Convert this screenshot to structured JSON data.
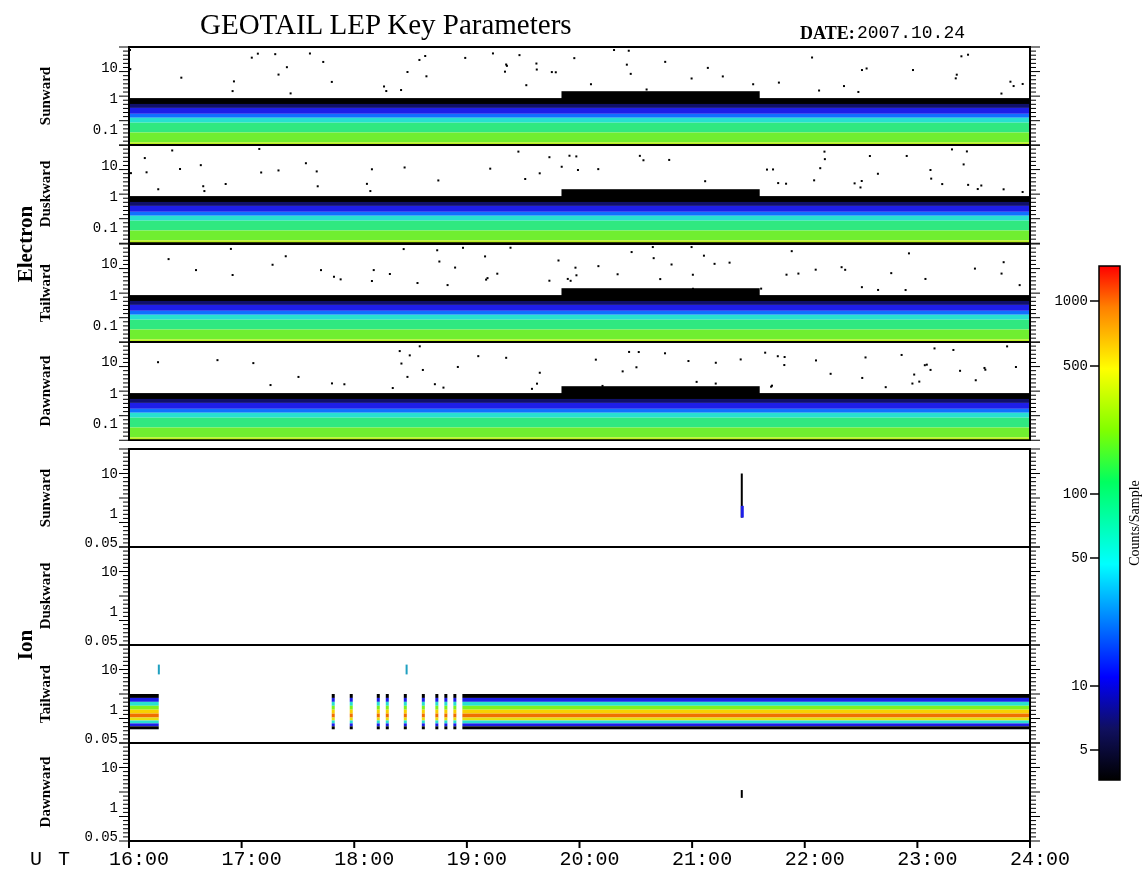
{
  "title": "GEOTAIL LEP Key Parameters",
  "date_label": "DATE:",
  "date": "2007.10.24",
  "groups": [
    {
      "label": "Electron",
      "panels": [
        {
          "label": "Sunward",
          "kind": "band",
          "yticks": [
            "10",
            "1",
            "0.1"
          ]
        },
        {
          "label": "Duskward",
          "kind": "band",
          "yticks": [
            "10",
            "1",
            "0.1"
          ]
        },
        {
          "label": "Tailward",
          "kind": "band",
          "yticks": [
            "10",
            "1",
            "0.1"
          ]
        },
        {
          "label": "Dawnward",
          "kind": "band",
          "yticks": [
            "10",
            "1",
            "0.1"
          ]
        }
      ]
    },
    {
      "label": "Ion",
      "panels": [
        {
          "label": "Sunward",
          "kind": "spike",
          "yticks": [
            "10",
            "1",
            "0.05"
          ]
        },
        {
          "label": "Duskward",
          "kind": "empty",
          "yticks": [
            "10",
            "1",
            "0.05"
          ]
        },
        {
          "label": "Tailward",
          "kind": "ion-band",
          "yticks": [
            "10",
            "1",
            "0.05"
          ]
        },
        {
          "label": "Dawnward",
          "kind": "dot",
          "yticks": [
            "10",
            "1",
            "0.05"
          ]
        }
      ]
    }
  ],
  "x_axis": {
    "label": "U T",
    "ticks": [
      "16:00",
      "17:00",
      "18:00",
      "19:00",
      "20:00",
      "21:00",
      "22:00",
      "23:00",
      "24:00"
    ]
  },
  "colorbar": {
    "label": "Counts/Sample",
    "ticks": [
      "1000",
      "500",
      "100",
      "50",
      "10",
      "5"
    ]
  }
}
